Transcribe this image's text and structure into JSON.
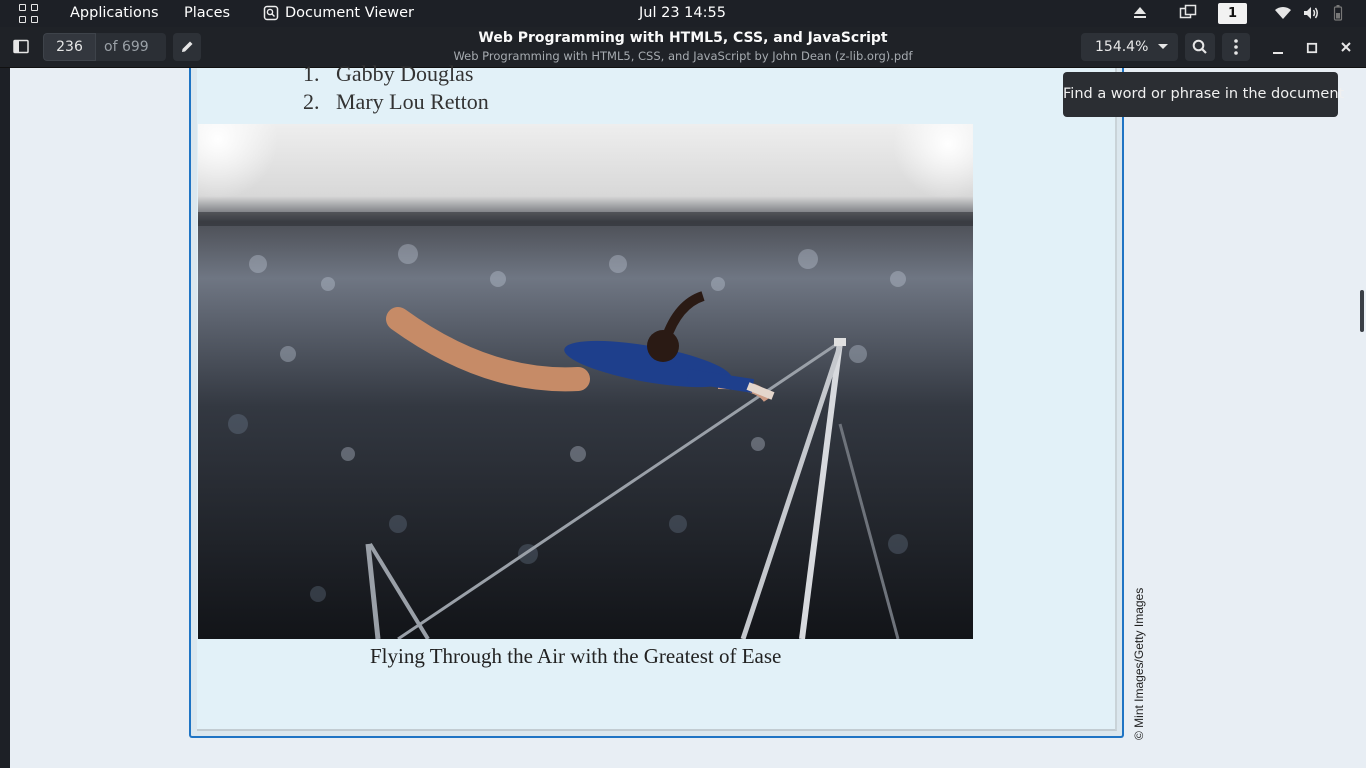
{
  "topbar": {
    "applications_label": "Applications",
    "places_label": "Places",
    "app_name": "Document Viewer",
    "clock": "Jul 23  14:55",
    "workspace_number": "1"
  },
  "headerbar": {
    "current_page": "236",
    "page_total": "of 699",
    "title": "Web Programming with HTML5, CSS, and JavaScript",
    "subtitle": "Web Programming with HTML5, CSS, and JavaScript by John Dean (z-lib.org).pdf",
    "zoom": "154.4%"
  },
  "document": {
    "list_items": [
      {
        "number": "1.",
        "text": "Gabby Douglas"
      },
      {
        "number": "2.",
        "text": "Mary Lou Retton"
      }
    ],
    "caption": "Flying Through the Air with the Greatest of Ease",
    "photo_credit": "© Mint Images/Getty Images"
  },
  "tooltip": "Find a word or phrase in the document"
}
